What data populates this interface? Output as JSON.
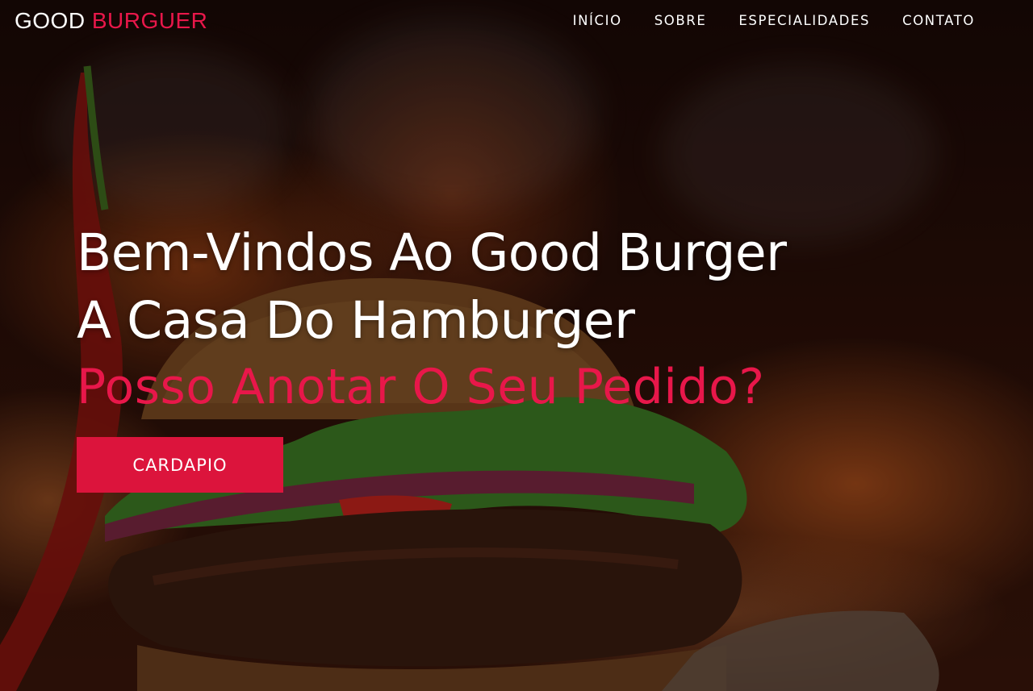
{
  "header": {
    "logo_part1": "GOOD",
    "logo_part2": "BURGUER",
    "nav": [
      {
        "label": "INÍCIO"
      },
      {
        "label": "SOBRE"
      },
      {
        "label": "ESPECIALIDADES"
      },
      {
        "label": "CONTATO"
      }
    ]
  },
  "hero": {
    "line1": "Bem-Vindos Ao Good Burger",
    "line2": "A Casa Do Hamburger",
    "subtitle": "Posso Anotar O Seu Pedido?",
    "cta_label": "CARDAPIO"
  },
  "colors": {
    "accent": "#dc143c",
    "logo_accent": "#e8174a",
    "text": "#ffffff"
  }
}
